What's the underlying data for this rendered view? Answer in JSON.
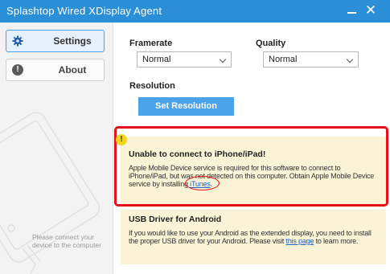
{
  "window": {
    "title": "Splashtop Wired XDisplay Agent"
  },
  "sidebar": {
    "items": [
      {
        "label": "Settings",
        "icon": "gear-icon",
        "active": true
      },
      {
        "label": "About",
        "icon": "info-icon",
        "active": false
      }
    ],
    "connect_hint": "Please connect your device to the computer"
  },
  "settings": {
    "framerate": {
      "label": "Framerate",
      "value": "Normal"
    },
    "quality": {
      "label": "Quality",
      "value": "Normal"
    },
    "resolution": {
      "label": "Resolution",
      "button_label": "Set Resolution"
    }
  },
  "warning": {
    "icon": "warning-icon",
    "title": "Unable to connect to iPhone/iPad!",
    "body": "Apple Mobile Device service is required for this software to connect to iPhone/iPad, but was not detected on this computer. Obtain Apple Mobile Device service by installing",
    "link": "iTunes",
    "trailing": "."
  },
  "usb": {
    "title": "USB Driver for Android",
    "body": "If you would like to use your Android as the extended display, you need to install the proper USB driver for your Android. Please visit",
    "link": "this page",
    "trailing": "to learn more."
  },
  "colors": {
    "accent": "#4aa3e8",
    "titlebar": "#2a8fd6",
    "highlight": "#e4121b",
    "panel_bg": "#fbf3d6",
    "warning": "#f3d51a"
  }
}
